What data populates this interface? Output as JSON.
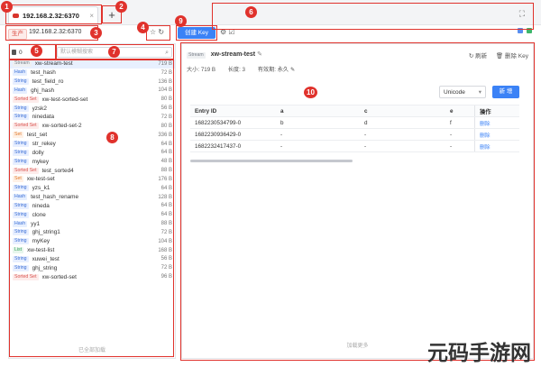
{
  "tab": {
    "title": "192.168.2.32:6370",
    "close": "×"
  },
  "new_tab": "+",
  "connection": {
    "env_tag": "生产",
    "address": "192.168.2.32:6370"
  },
  "toolbar": {
    "favorite_icon": "☆",
    "refresh_icon": "↻",
    "create_key": "创建 Key",
    "settings_icon": "⚙",
    "terminal_icon": "☑"
  },
  "expand_icon": "⛶",
  "db_selector": {
    "value": "0",
    "arrow": "▾"
  },
  "search": {
    "placeholder": "默认模糊搜索"
  },
  "keys": [
    {
      "type": "Stream",
      "name": "xw-stream-test",
      "size": "719 B",
      "selected": true
    },
    {
      "type": "Hash",
      "name": "test_hash",
      "size": "72 B"
    },
    {
      "type": "String",
      "name": "test_field_ro",
      "size": "136 B"
    },
    {
      "type": "Hash",
      "name": "ghj_hash",
      "size": "104 B"
    },
    {
      "type": "Sorted Set",
      "name": "xw-test-sorted-set",
      "size": "80 B"
    },
    {
      "type": "String",
      "name": "yzsk2",
      "size": "56 B"
    },
    {
      "type": "String",
      "name": "ninedata",
      "size": "72 B"
    },
    {
      "type": "Sorted Set",
      "name": "xw-sorted-set-2",
      "size": "80 B"
    },
    {
      "type": "Set",
      "name": "test_set",
      "size": "336 B"
    },
    {
      "type": "String",
      "name": "str_rekey",
      "size": "64 B"
    },
    {
      "type": "String",
      "name": "dolly",
      "size": "64 B"
    },
    {
      "type": "String",
      "name": "mykey",
      "size": "48 B"
    },
    {
      "type": "Sorted Set",
      "name": "test_sorted4",
      "size": "88 B"
    },
    {
      "type": "Set",
      "name": "xw-test-set",
      "size": "176 B"
    },
    {
      "type": "String",
      "name": "yzs_k1",
      "size": "64 B"
    },
    {
      "type": "Hash",
      "name": "test_hash_rename",
      "size": "128 B"
    },
    {
      "type": "String",
      "name": "nineda",
      "size": "64 B"
    },
    {
      "type": "String",
      "name": "clone",
      "size": "64 B"
    },
    {
      "type": "Hash",
      "name": "yy1",
      "size": "88 B"
    },
    {
      "type": "String",
      "name": "ghj_string1",
      "size": "72 B"
    },
    {
      "type": "String",
      "name": "myKey",
      "size": "104 B"
    },
    {
      "type": "List",
      "name": "xw-test-list",
      "size": "168 B"
    },
    {
      "type": "String",
      "name": "xuwei_test",
      "size": "56 B"
    },
    {
      "type": "String",
      "name": "ghj_string",
      "size": "72 B"
    },
    {
      "type": "Sorted Set",
      "name": "xw-sorted-set",
      "size": "96 B"
    }
  ],
  "list_footer": "已全部加载",
  "detail": {
    "type": "Stream",
    "key": "xw-stream-test",
    "edit_icon": "✎",
    "refresh_label": "↻ 刷新",
    "delete_label": "🗑 删除 Key",
    "size": "大小: 719 B",
    "length": "长度: 3",
    "ttl": "有效期: 永久 ✎",
    "format": "Unicode",
    "format_arrow": "▾",
    "add_label": "新 增",
    "columns": [
      "Entry ID",
      "a",
      "c",
      "e",
      "操作"
    ],
    "rows": [
      {
        "id": "1682230534799-0",
        "a": "b",
        "c": "d",
        "e": "f",
        "op": "删除"
      },
      {
        "id": "1682230936429-0",
        "a": "-",
        "c": "-",
        "e": "-",
        "op": "删除"
      },
      {
        "id": "1682232417437-0",
        "a": "-",
        "c": "-",
        "e": "-",
        "op": "删除"
      }
    ],
    "load_more": "加载更多"
  },
  "markers": [
    "1",
    "2",
    "3",
    "4",
    "5",
    "6",
    "7",
    "8",
    "9",
    "10"
  ],
  "watermark": "元码手游网",
  "type_colors": {
    "Stream": {
      "bg": "#eef0f2",
      "fg": "#7a8089"
    },
    "Hash": {
      "bg": "#e6efff",
      "fg": "#3b6fd6"
    },
    "String": {
      "bg": "#e8efff",
      "fg": "#3b6fd6"
    },
    "Sorted Set": {
      "bg": "#fdeceb",
      "fg": "#d9534f"
    },
    "Set": {
      "bg": "#fff1e6",
      "fg": "#e07a2e"
    },
    "List": {
      "bg": "#e7f6ec",
      "fg": "#2e9d57"
    }
  }
}
